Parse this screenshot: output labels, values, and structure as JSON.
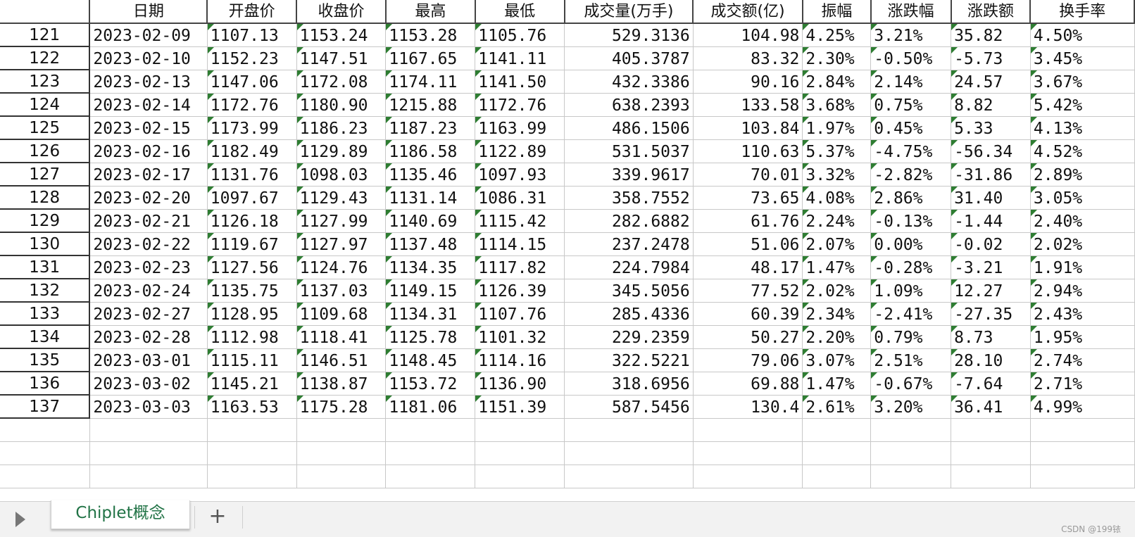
{
  "headers": [
    "",
    "日期",
    "开盘价",
    "收盘价",
    "最高",
    "最低",
    "成交量(万手)",
    "成交额(亿)",
    "振幅",
    "涨跌幅",
    "涨跌额",
    "换手率"
  ],
  "rows": [
    [
      "121",
      "2023-02-09",
      "1107.13",
      "1153.24",
      "1153.28",
      "1105.76",
      "529.3136",
      "104.98",
      "4.25%",
      "3.21%",
      "35.82",
      "4.50%"
    ],
    [
      "122",
      "2023-02-10",
      "1152.23",
      "1147.51",
      "1167.65",
      "1141.11",
      "405.3787",
      "83.32",
      "2.30%",
      "-0.50%",
      "-5.73",
      "3.45%"
    ],
    [
      "123",
      "2023-02-13",
      "1147.06",
      "1172.08",
      "1174.11",
      "1141.50",
      "432.3386",
      "90.16",
      "2.84%",
      "2.14%",
      "24.57",
      "3.67%"
    ],
    [
      "124",
      "2023-02-14",
      "1172.76",
      "1180.90",
      "1215.88",
      "1172.76",
      "638.2393",
      "133.58",
      "3.68%",
      "0.75%",
      "8.82",
      "5.42%"
    ],
    [
      "125",
      "2023-02-15",
      "1173.99",
      "1186.23",
      "1187.23",
      "1163.99",
      "486.1506",
      "103.84",
      "1.97%",
      "0.45%",
      "5.33",
      "4.13%"
    ],
    [
      "126",
      "2023-02-16",
      "1182.49",
      "1129.89",
      "1186.58",
      "1122.89",
      "531.5037",
      "110.63",
      "5.37%",
      "-4.75%",
      "-56.34",
      "4.52%"
    ],
    [
      "127",
      "2023-02-17",
      "1131.76",
      "1098.03",
      "1135.46",
      "1097.93",
      "339.9617",
      "70.01",
      "3.32%",
      "-2.82%",
      "-31.86",
      "2.89%"
    ],
    [
      "128",
      "2023-02-20",
      "1097.67",
      "1129.43",
      "1131.14",
      "1086.31",
      "358.7552",
      "73.65",
      "4.08%",
      "2.86%",
      "31.40",
      "3.05%"
    ],
    [
      "129",
      "2023-02-21",
      "1126.18",
      "1127.99",
      "1140.69",
      "1115.42",
      "282.6882",
      "61.76",
      "2.24%",
      "-0.13%",
      "-1.44",
      "2.40%"
    ],
    [
      "130",
      "2023-02-22",
      "1119.67",
      "1127.97",
      "1137.48",
      "1114.15",
      "237.2478",
      "51.06",
      "2.07%",
      "0.00%",
      "-0.02",
      "2.02%"
    ],
    [
      "131",
      "2023-02-23",
      "1127.56",
      "1124.76",
      "1134.35",
      "1117.82",
      "224.7984",
      "48.17",
      "1.47%",
      "-0.28%",
      "-3.21",
      "1.91%"
    ],
    [
      "132",
      "2023-02-24",
      "1135.75",
      "1137.03",
      "1149.15",
      "1126.39",
      "345.5056",
      "77.52",
      "2.02%",
      "1.09%",
      "12.27",
      "2.94%"
    ],
    [
      "133",
      "2023-02-27",
      "1128.95",
      "1109.68",
      "1134.31",
      "1107.76",
      "285.4336",
      "60.39",
      "2.34%",
      "-2.41%",
      "-27.35",
      "2.43%"
    ],
    [
      "134",
      "2023-02-28",
      "1112.98",
      "1118.41",
      "1125.78",
      "1101.32",
      "229.2359",
      "50.27",
      "2.20%",
      "0.79%",
      "8.73",
      "1.95%"
    ],
    [
      "135",
      "2023-03-01",
      "1115.11",
      "1146.51",
      "1148.45",
      "1114.16",
      "322.5221",
      "79.06",
      "3.07%",
      "2.51%",
      "28.10",
      "2.74%"
    ],
    [
      "136",
      "2023-03-02",
      "1145.21",
      "1138.87",
      "1153.72",
      "1136.90",
      "318.6956",
      "69.88",
      "1.47%",
      "-0.67%",
      "-7.64",
      "2.71%"
    ],
    [
      "137",
      "2023-03-03",
      "1163.53",
      "1175.28",
      "1181.06",
      "1151.39",
      "587.5456",
      "130.4",
      "2.61%",
      "3.20%",
      "36.41",
      "4.99%"
    ]
  ],
  "tabs": {
    "sheet_name": "Chiplet概念",
    "add_label": "+"
  },
  "watermark": "CSDN @199铱",
  "colors": {
    "accent": "#217346",
    "flag": "#2e7d32"
  }
}
